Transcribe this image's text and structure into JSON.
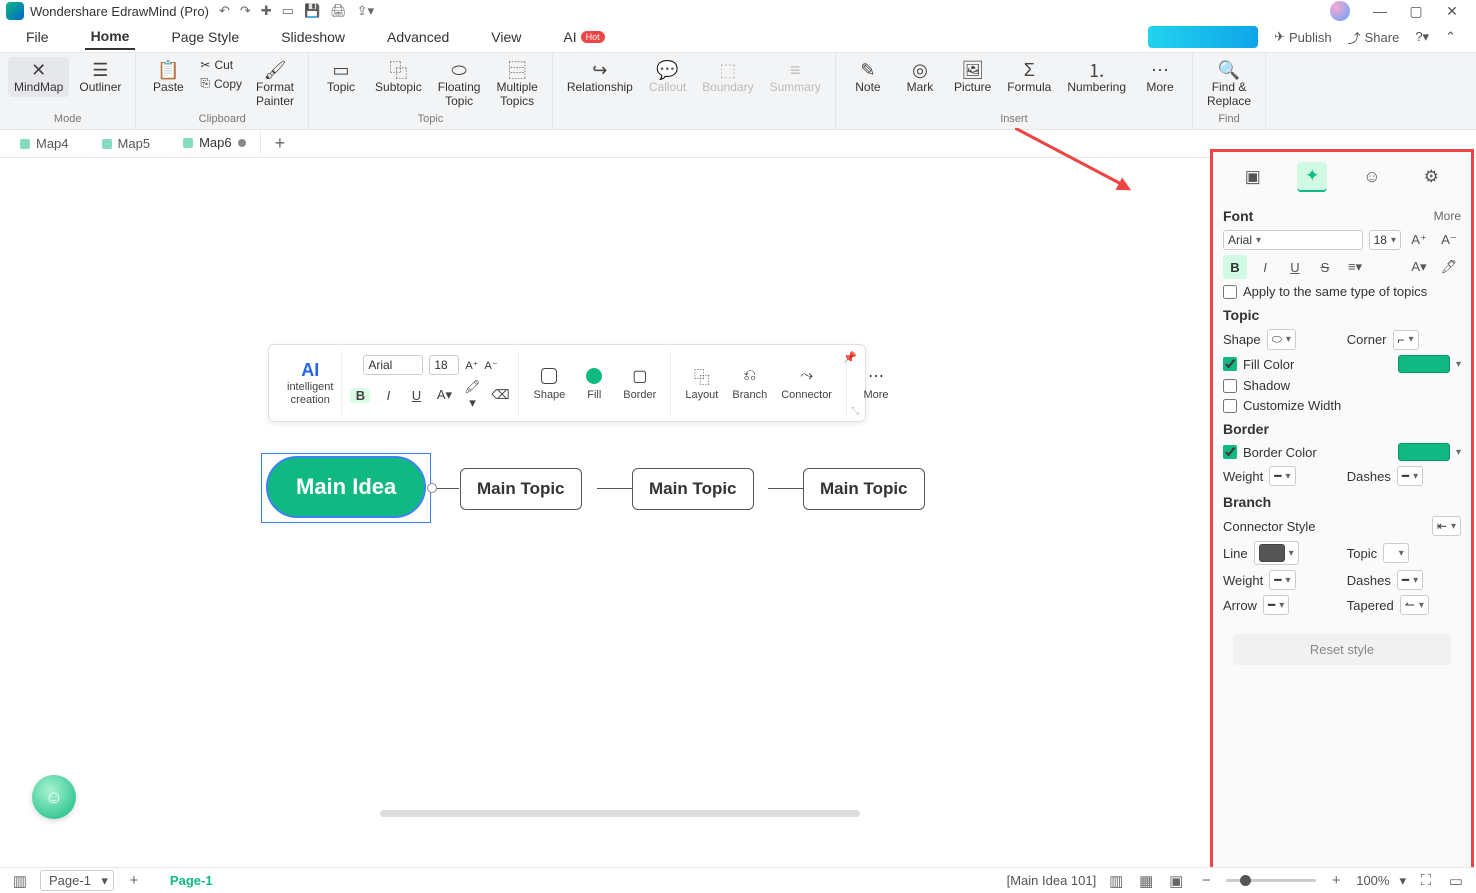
{
  "app": {
    "title": "Wondershare EdrawMind (Pro)"
  },
  "menu": {
    "items": [
      "File",
      "Home",
      "Page Style",
      "Slideshow",
      "Advanced",
      "View"
    ],
    "active": 1,
    "ai": "AI",
    "hot": "Hot",
    "publish": "Publish",
    "share": "Share"
  },
  "ribbon": {
    "mode": {
      "mindmap": "MindMap",
      "outliner": "Outliner",
      "label": "Mode"
    },
    "clipboard": {
      "paste": "Paste",
      "cut": "Cut",
      "copy": "Copy",
      "format_painter": "Format\nPainter",
      "label": "Clipboard"
    },
    "topic": {
      "topic": "Topic",
      "subtopic": "Subtopic",
      "floating": "Floating\nTopic",
      "multiple": "Multiple\nTopics",
      "label": "Topic"
    },
    "link": {
      "relationship": "Relationship",
      "callout": "Callout",
      "boundary": "Boundary",
      "summary": "Summary"
    },
    "insert": {
      "note": "Note",
      "mark": "Mark",
      "picture": "Picture",
      "formula": "Formula",
      "numbering": "Numbering",
      "more": "More",
      "label": "Insert"
    },
    "find": {
      "find_replace": "Find &\nReplace",
      "label": "Find"
    }
  },
  "tabs": {
    "t1": "Map4",
    "t2": "Map5",
    "t3": "Map6"
  },
  "floatbar": {
    "ai": "AI",
    "ai_sub": "intelligent\ncreation",
    "font": "Arial",
    "size": "18",
    "shape": "Shape",
    "fill": "Fill",
    "border": "Border",
    "layout": "Layout",
    "branch": "Branch",
    "connector": "Connector",
    "more": "More"
  },
  "nodes": {
    "main": "Main Idea",
    "t1": "Main Topic",
    "t2": "Main Topic",
    "t3": "Main Topic"
  },
  "panel": {
    "font_head": "Font",
    "more": "More",
    "font_name": "Arial",
    "font_size": "18",
    "apply_same": "Apply to the same type of topics",
    "topic_head": "Topic",
    "shape": "Shape",
    "corner": "Corner",
    "fill": "Fill Color",
    "shadow": "Shadow",
    "custom_w": "Customize Width",
    "border_head": "Border",
    "border_color": "Border Color",
    "weight": "Weight",
    "dashes": "Dashes",
    "branch_head": "Branch",
    "conn_style": "Connector Style",
    "line": "Line",
    "topic": "Topic",
    "arrow": "Arrow",
    "tapered": "Tapered",
    "reset": "Reset style"
  },
  "status": {
    "page_sel": "Page-1",
    "page_tab": "Page-1",
    "selection": "[Main Idea 101]",
    "zoom": "100%"
  }
}
